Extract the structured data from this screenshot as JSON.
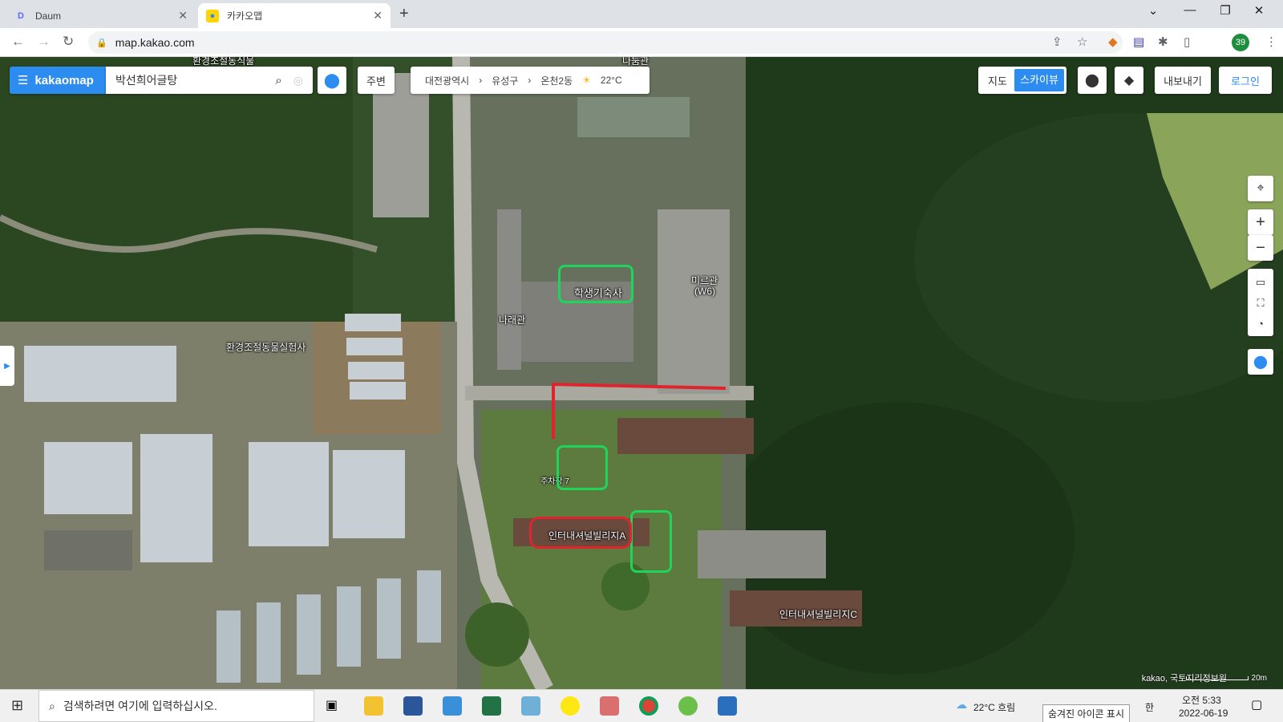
{
  "browser": {
    "tabs": [
      {
        "title": "Daum",
        "icon": "daum-icon"
      },
      {
        "title": "카카오맵",
        "icon": "kakaomap-icon"
      }
    ],
    "url": "map.kakao.com",
    "profile_badge": "39"
  },
  "map": {
    "logo": "kakaomap",
    "search_query": "박선희어글탕",
    "nearby_label": "주변",
    "breadcrumb": [
      "대전광역시",
      "유성구",
      "온천2동"
    ],
    "weather": "22°C",
    "map_type": {
      "off": "지도",
      "on": "스카이뷰"
    },
    "export_label": "내보내기",
    "login_label": "로그인",
    "place_labels": [
      "학생기숙사",
      "미르관",
      "(W6)",
      "나래관",
      "환경조절동물실험사",
      "주차장 7",
      "인터내셔널빌리지A",
      "인터내셔널빌리지C",
      "나둠관",
      "환경조절동식물"
    ],
    "attribution": "kakao, 국토지리정보원",
    "scale": "20m"
  },
  "taskbar": {
    "search_placeholder": "검색하려면 여기에 입력하십시오.",
    "weather": "22°C  흐림",
    "ime": "한",
    "time": "오전 5:33",
    "date": "2022-06-19",
    "tooltip": "숨겨진 아이콘 표시"
  },
  "colors": {
    "accent": "#2d8cf0",
    "annot_green": "#1fd45a",
    "annot_red": "#e0242d"
  }
}
